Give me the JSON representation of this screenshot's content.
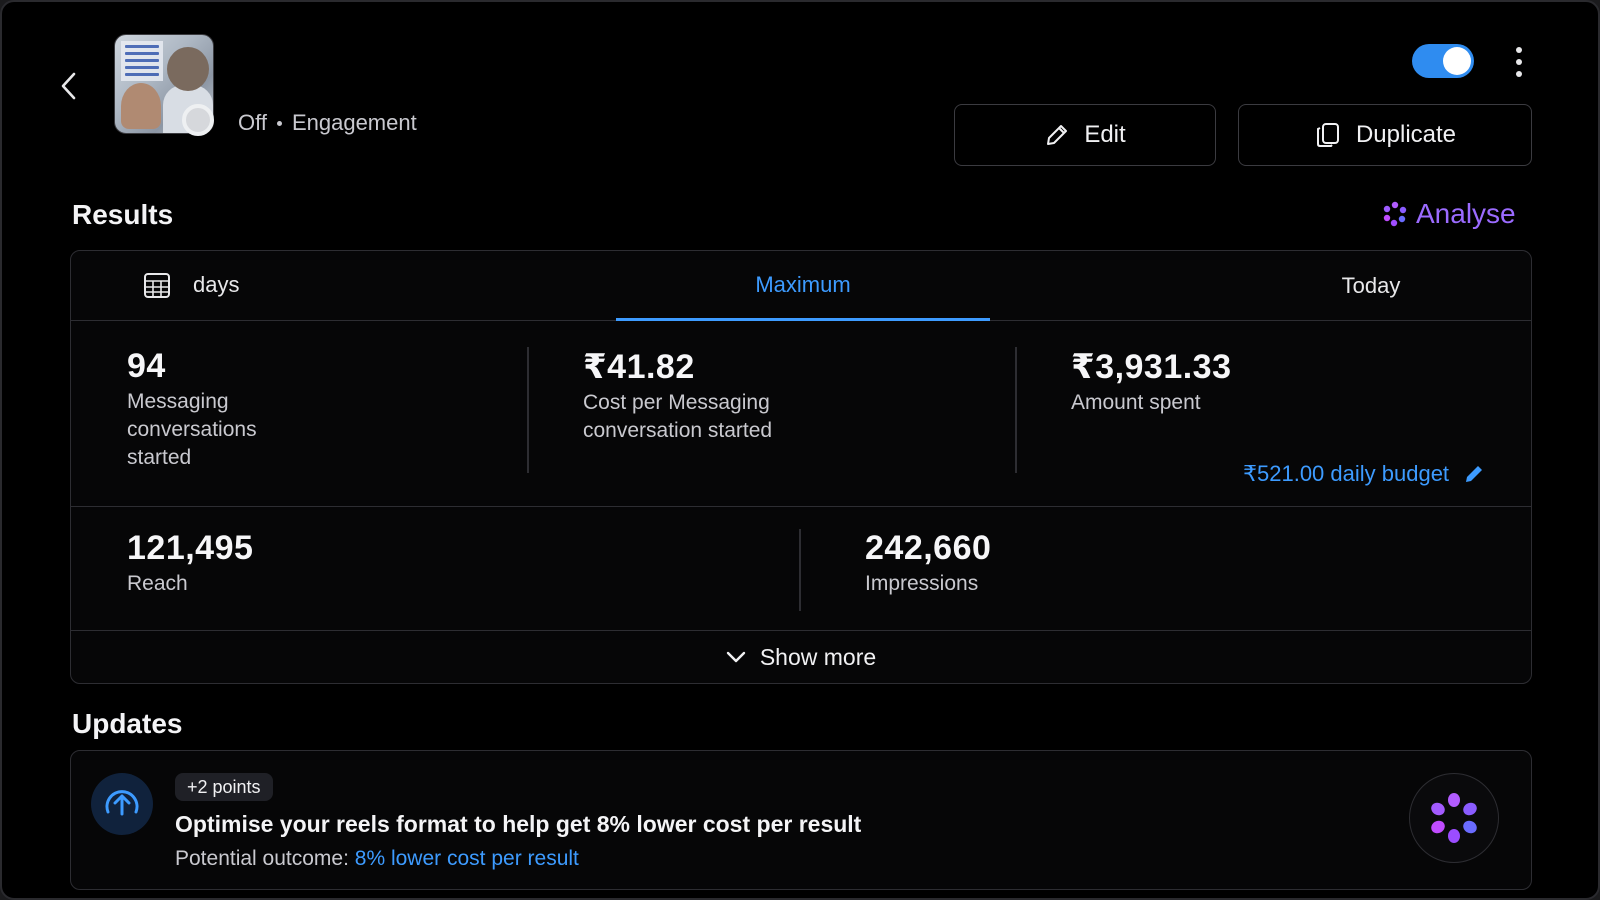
{
  "header": {
    "status": "Off",
    "objective": "Engagement",
    "toggle_on": true,
    "edit_label": "Edit",
    "duplicate_label": "Duplicate"
  },
  "results": {
    "title": "Results",
    "analyse_label": "Analyse",
    "tabs": {
      "days_label": "days",
      "maximum_label": "Maximum",
      "today_label": "Today",
      "active": "Maximum"
    },
    "metrics": [
      {
        "value": "94",
        "label_lines": [
          "Messaging",
          "conversations",
          "started"
        ]
      },
      {
        "value": "₹41.82",
        "label_lines": [
          "Cost per Messaging",
          "conversation started"
        ]
      },
      {
        "value": "₹3,931.33",
        "label_lines": [
          "Amount spent"
        ]
      }
    ],
    "budget_label": "₹521.00 daily budget",
    "reach": {
      "value": "121,495",
      "label": "Reach"
    },
    "impressions": {
      "value": "242,660",
      "label": "Impressions"
    },
    "show_more_label": "Show more"
  },
  "updates": {
    "title": "Updates",
    "points_badge": "+2 points",
    "headline": "Optimise your reels format to help get 8% lower cost per result",
    "outcome_prefix": "Potential outcome:",
    "outcome_value": "8% lower cost per result"
  },
  "colors": {
    "accent_blue": "#3d9bff",
    "toggle_blue": "#2f8cf0",
    "ai_purple": "#9b6bff",
    "background": "#000000"
  }
}
